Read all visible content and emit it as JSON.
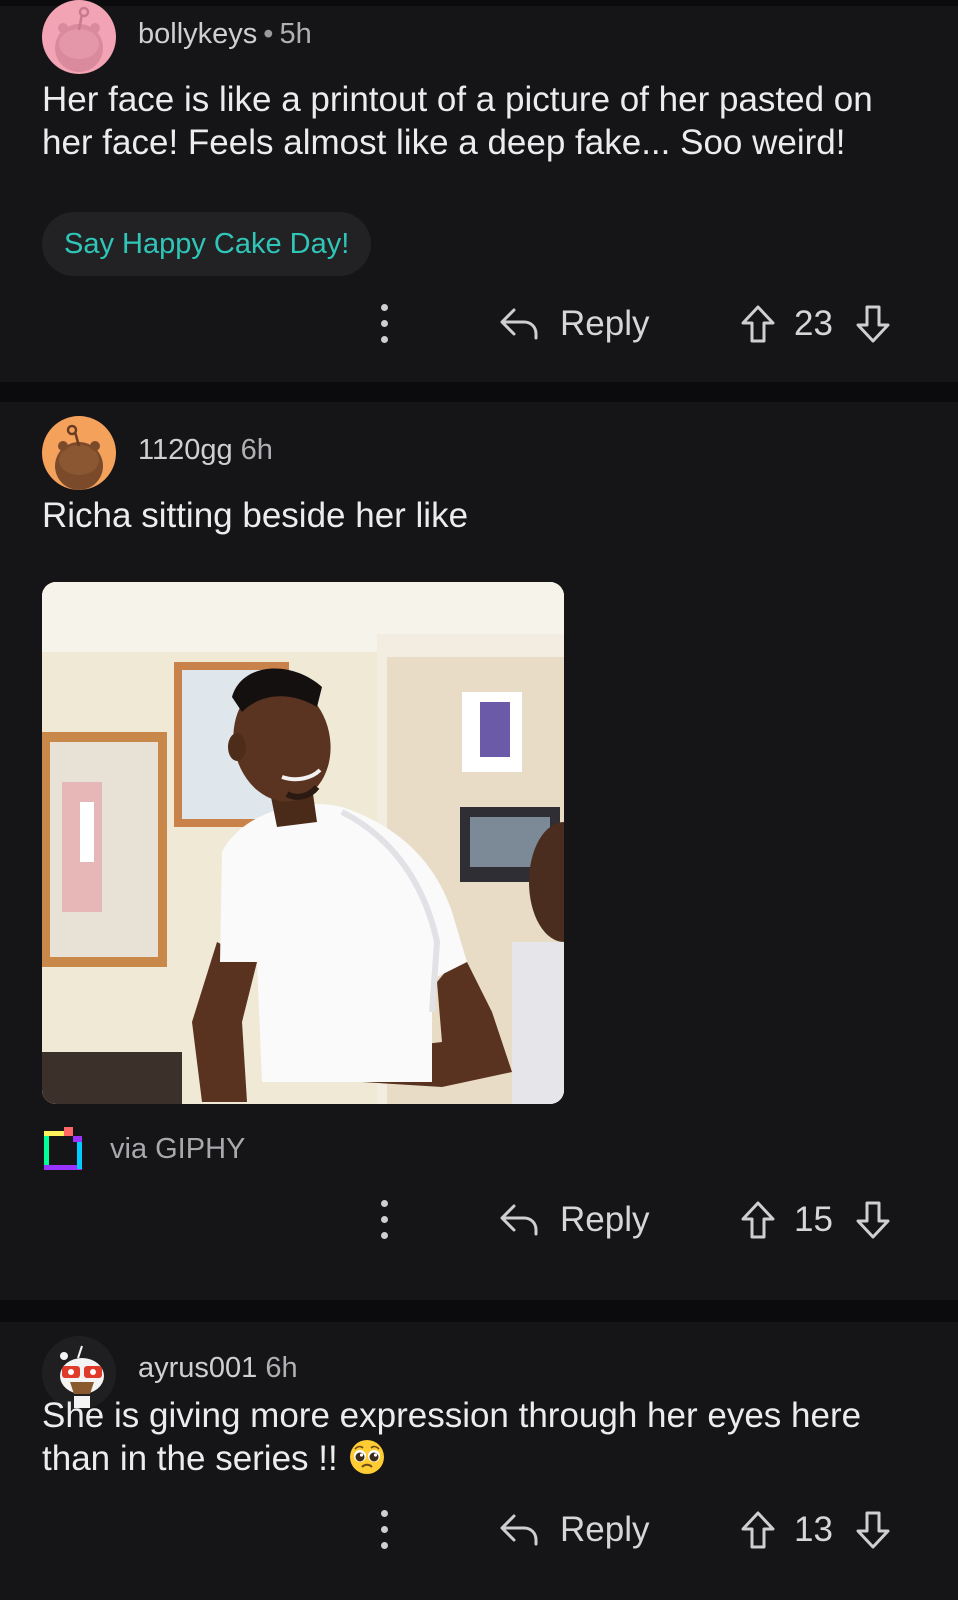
{
  "comments": [
    {
      "username": "bollykeys",
      "separator": "•",
      "time": "5h",
      "text": "Her face is like a printout of a picture of her pasted on her face! Feels almost like a deep fake... Soo weird!",
      "cake_day_button": "Say Happy Cake Day!",
      "reply_label": "Reply",
      "votes": "23"
    },
    {
      "username": "1120gg",
      "time": "6h",
      "text": "Richa sitting beside her like",
      "attribution": "via GIPHY",
      "reply_label": "Reply",
      "votes": "15"
    },
    {
      "username": "ayrus001",
      "time": "6h",
      "text": "She is giving more expression through her eyes here than in the series !!",
      "emoji": "pleading-face",
      "reply_label": "Reply",
      "votes": "13"
    }
  ],
  "colors": {
    "background": "#0b0b0d",
    "card": "#151517",
    "cake_text": "#2fc6b8",
    "avatar1": "#f2a3b4",
    "avatar2": "#f4a15c"
  }
}
